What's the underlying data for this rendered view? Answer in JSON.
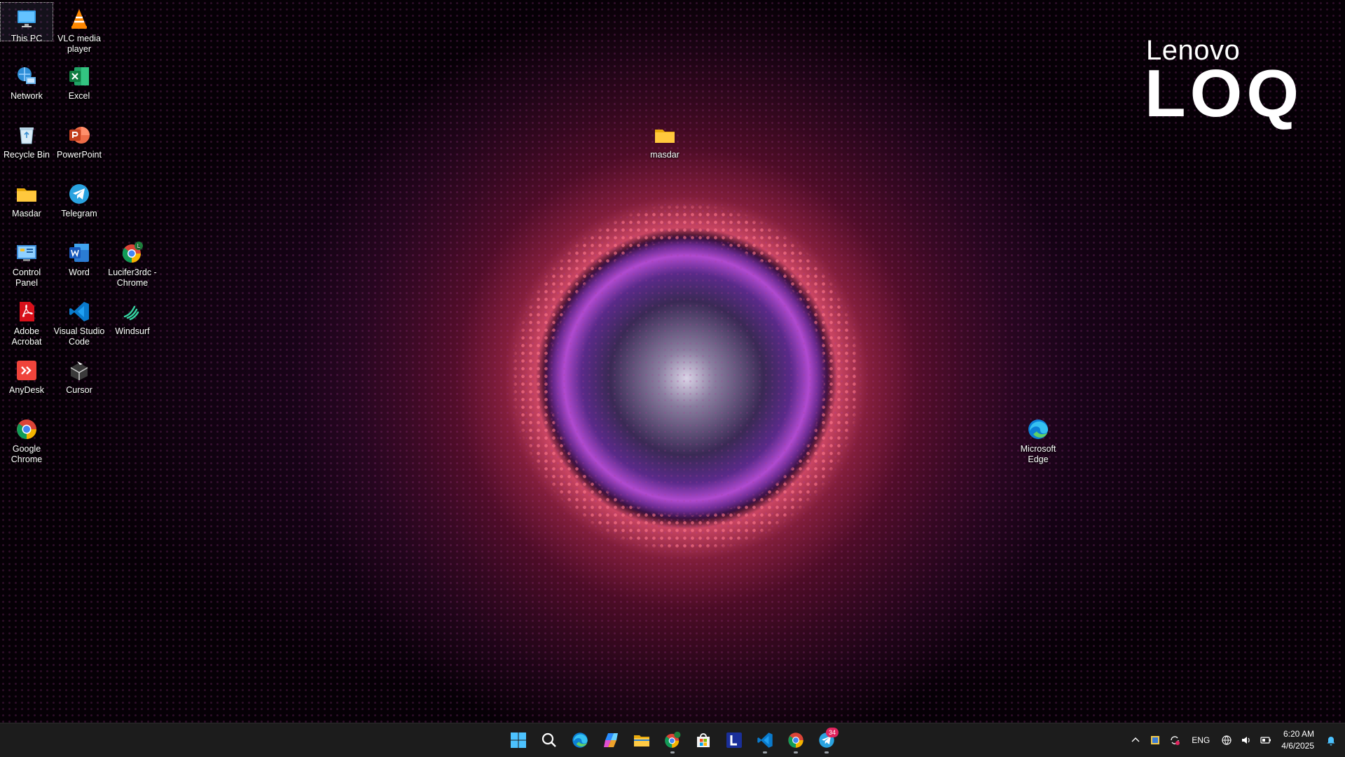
{
  "wallpaper": {
    "brand_top": "Lenovo",
    "brand_bottom": "LOQ"
  },
  "desktop_icons": [
    {
      "id": "this-pc",
      "label": "This PC",
      "icon": "this-pc-icon"
    },
    {
      "id": "vlc",
      "label": "VLC media player",
      "icon": "vlc-icon"
    },
    {
      "id": "network",
      "label": "Network",
      "icon": "network-icon"
    },
    {
      "id": "excel",
      "label": "Excel",
      "icon": "excel-icon"
    },
    {
      "id": "recycle-bin",
      "label": "Recycle Bin",
      "icon": "recycle-bin-icon"
    },
    {
      "id": "powerpoint",
      "label": "PowerPoint",
      "icon": "powerpoint-icon"
    },
    {
      "id": "masdar",
      "label": "Masdar",
      "icon": "folder-icon"
    },
    {
      "id": "telegram",
      "label": "Telegram",
      "icon": "telegram-icon"
    },
    {
      "id": "control-panel",
      "label": "Control Panel",
      "icon": "control-panel-icon"
    },
    {
      "id": "word",
      "label": "Word",
      "icon": "word-icon"
    },
    {
      "id": "lucifer-chrome",
      "label": "Lucifer3rdc - Chrome",
      "icon": "chrome-profile-icon"
    },
    {
      "id": "adobe-acrobat",
      "label": "Adobe Acrobat",
      "icon": "acrobat-icon"
    },
    {
      "id": "vscode",
      "label": "Visual Studio Code",
      "icon": "vscode-icon"
    },
    {
      "id": "windsurf",
      "label": "Windsurf",
      "icon": "windsurf-icon"
    },
    {
      "id": "anydesk",
      "label": "AnyDesk",
      "icon": "anydesk-icon"
    },
    {
      "id": "cursor",
      "label": "Cursor",
      "icon": "cursor-icon"
    },
    {
      "id": "google-chrome",
      "label": "Google Chrome",
      "icon": "chrome-icon"
    },
    {
      "id": "masdar-folder-center",
      "label": "masdar",
      "icon": "folder-icon"
    },
    {
      "id": "microsoft-edge",
      "label": "Microsoft Edge",
      "icon": "edge-icon"
    }
  ],
  "taskbar": {
    "apps": [
      {
        "id": "start",
        "icon": "windows-start-icon"
      },
      {
        "id": "search",
        "icon": "search-icon"
      },
      {
        "id": "edge",
        "icon": "edge-icon"
      },
      {
        "id": "copilot",
        "icon": "copilot-icon"
      },
      {
        "id": "file-explorer",
        "icon": "file-explorer-icon"
      },
      {
        "id": "chrome-profile",
        "icon": "chrome-profile-icon",
        "running": true
      },
      {
        "id": "store",
        "icon": "microsoft-store-icon"
      },
      {
        "id": "lenovo-vantage",
        "icon": "lenovo-l-icon"
      },
      {
        "id": "vscode",
        "icon": "vscode-icon",
        "running": true
      },
      {
        "id": "chrome",
        "icon": "chrome-icon",
        "running": true
      },
      {
        "id": "telegram",
        "icon": "telegram-icon",
        "running": true,
        "badge": "34"
      }
    ],
    "tray": {
      "language": "ENG",
      "time": "6:20 AM",
      "date": "4/6/2025"
    }
  }
}
